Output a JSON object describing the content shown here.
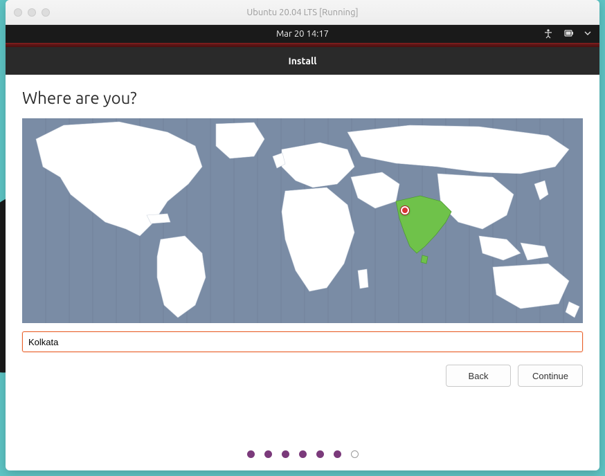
{
  "vm": {
    "title": "Ubuntu 20.04 LTS [Running]"
  },
  "topbar": {
    "datetime": "Mar 20  14:17"
  },
  "installer": {
    "header": "Install",
    "heading": "Where are you?",
    "timezone_value": "Kolkata",
    "back_label": "Back",
    "continue_label": "Continue"
  },
  "map": {
    "selected_region": "India",
    "pin": {
      "x_pct": 68.3,
      "y_pct": 45.0
    }
  },
  "pager": {
    "total": 7,
    "current": 6
  },
  "colors": {
    "accent": "#e9622c",
    "selected_region": "#6fc24a",
    "map_ocean": "#7a8ca5",
    "pager_dot": "#7b3a7b"
  }
}
